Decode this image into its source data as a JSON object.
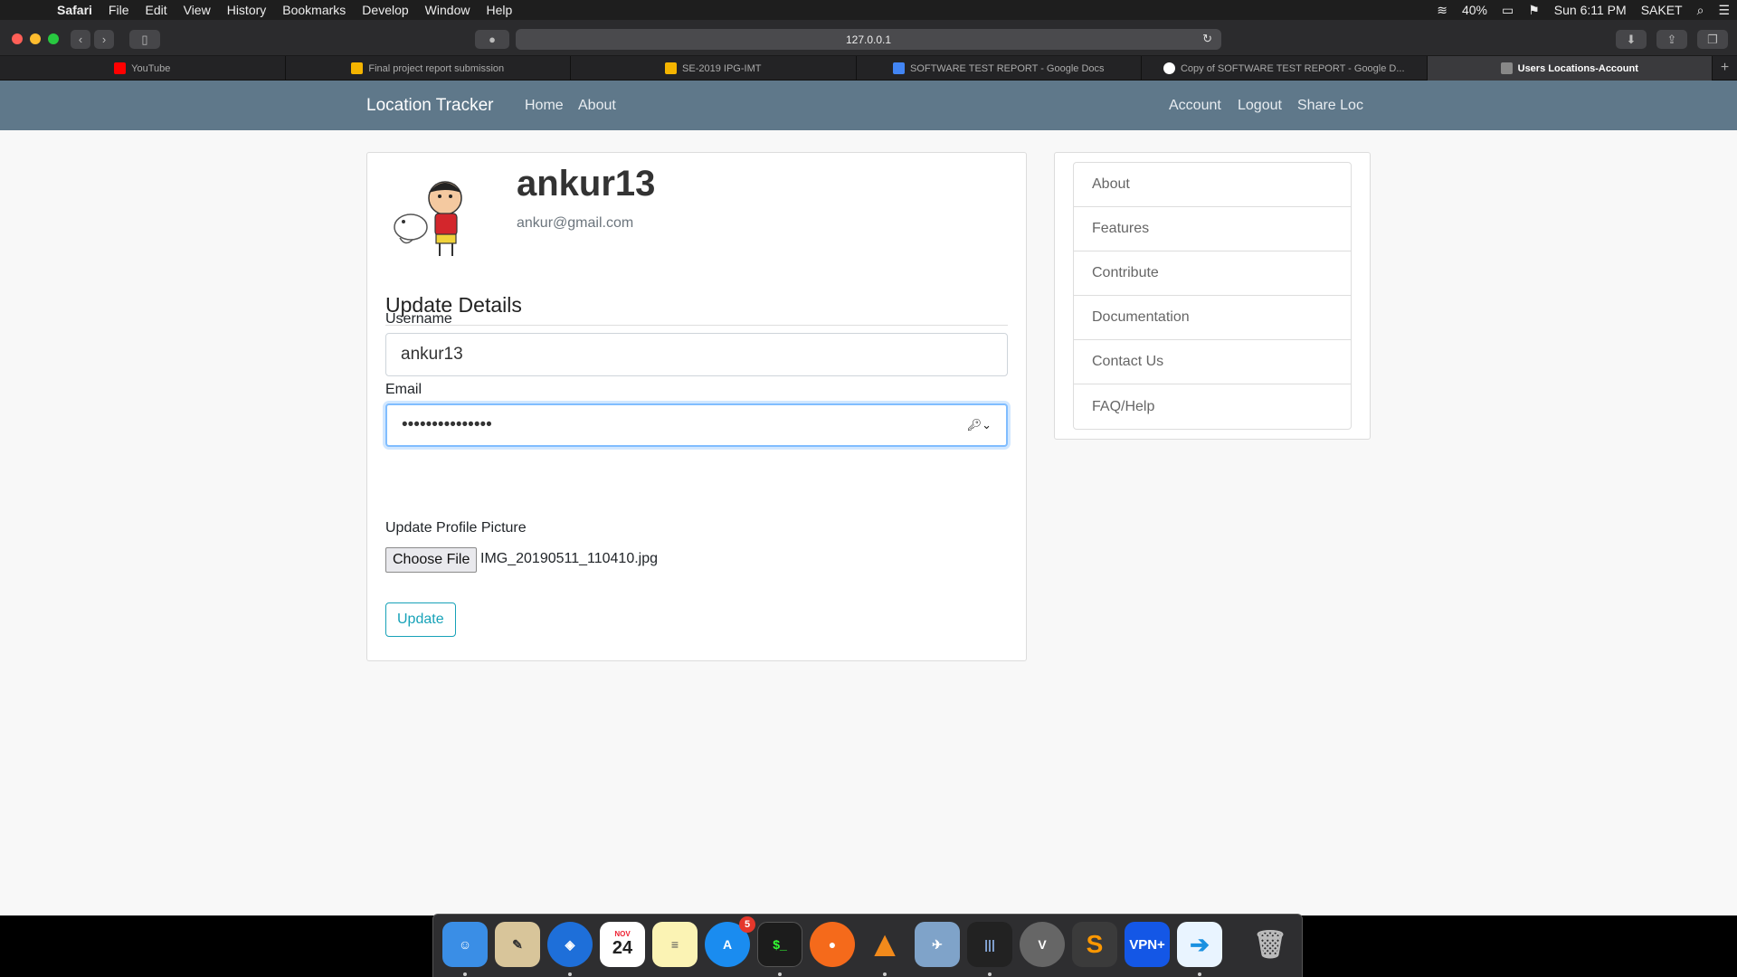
{
  "menubar": {
    "items": [
      "Safari",
      "File",
      "Edit",
      "View",
      "History",
      "Bookmarks",
      "Develop",
      "Window",
      "Help"
    ],
    "battery": "40%",
    "clock": "Sun 6:11 PM",
    "user": "SAKET"
  },
  "browser": {
    "url": "127.0.0.1",
    "tabs": [
      {
        "title": "YouTube",
        "icon": "youtube-icon",
        "color": "#ff0000"
      },
      {
        "title": "Final project report submission",
        "icon": "slides-icon",
        "color": "#f4b400"
      },
      {
        "title": "SE-2019 IPG-IMT",
        "icon": "slides-icon",
        "color": "#f4b400"
      },
      {
        "title": "SOFTWARE TEST REPORT - Google Docs",
        "icon": "docs-icon",
        "color": "#4285f4"
      },
      {
        "title": "Copy of SOFTWARE TEST REPORT - Google D...",
        "icon": "google-icon",
        "color": "#ffffff"
      },
      {
        "title": "Users Locations-Account",
        "icon": "page-icon",
        "color": "#888888",
        "active": true
      }
    ]
  },
  "navbar": {
    "brand": "Location Tracker",
    "left_links": [
      "Home",
      "About"
    ],
    "right_links": [
      "Account",
      "Logout",
      "Share Loc"
    ]
  },
  "profile": {
    "username": "ankur13",
    "email": "ankur@gmail.com"
  },
  "form": {
    "legend": "Update Details",
    "username_label": "Username",
    "username_value": "ankur13",
    "email_label": "Email",
    "email_value": "•••••••••••••••",
    "picture_label": "Update Profile Picture",
    "choose_file": "Choose File",
    "file_name": "IMG_20190511_110410.jpg",
    "submit": "Update"
  },
  "sidebar": {
    "items": [
      "About",
      "Features",
      "Contribute",
      "Documentation",
      "Contact Us",
      "FAQ/Help"
    ]
  },
  "dock": {
    "apps": [
      "Finder",
      "Preview",
      "Safari",
      "Calendar",
      "Notes",
      "App Store",
      "Terminal",
      "Firefox",
      "VLC",
      "Preview",
      "Activity Monitor",
      "Viscosity",
      "Sublime Text",
      "VPN+",
      "Migration Assistant",
      "Trash"
    ],
    "calendar_month": "NOV",
    "calendar_day": "24",
    "appstore_badge": "5",
    "vpn_label": "VPN+"
  }
}
